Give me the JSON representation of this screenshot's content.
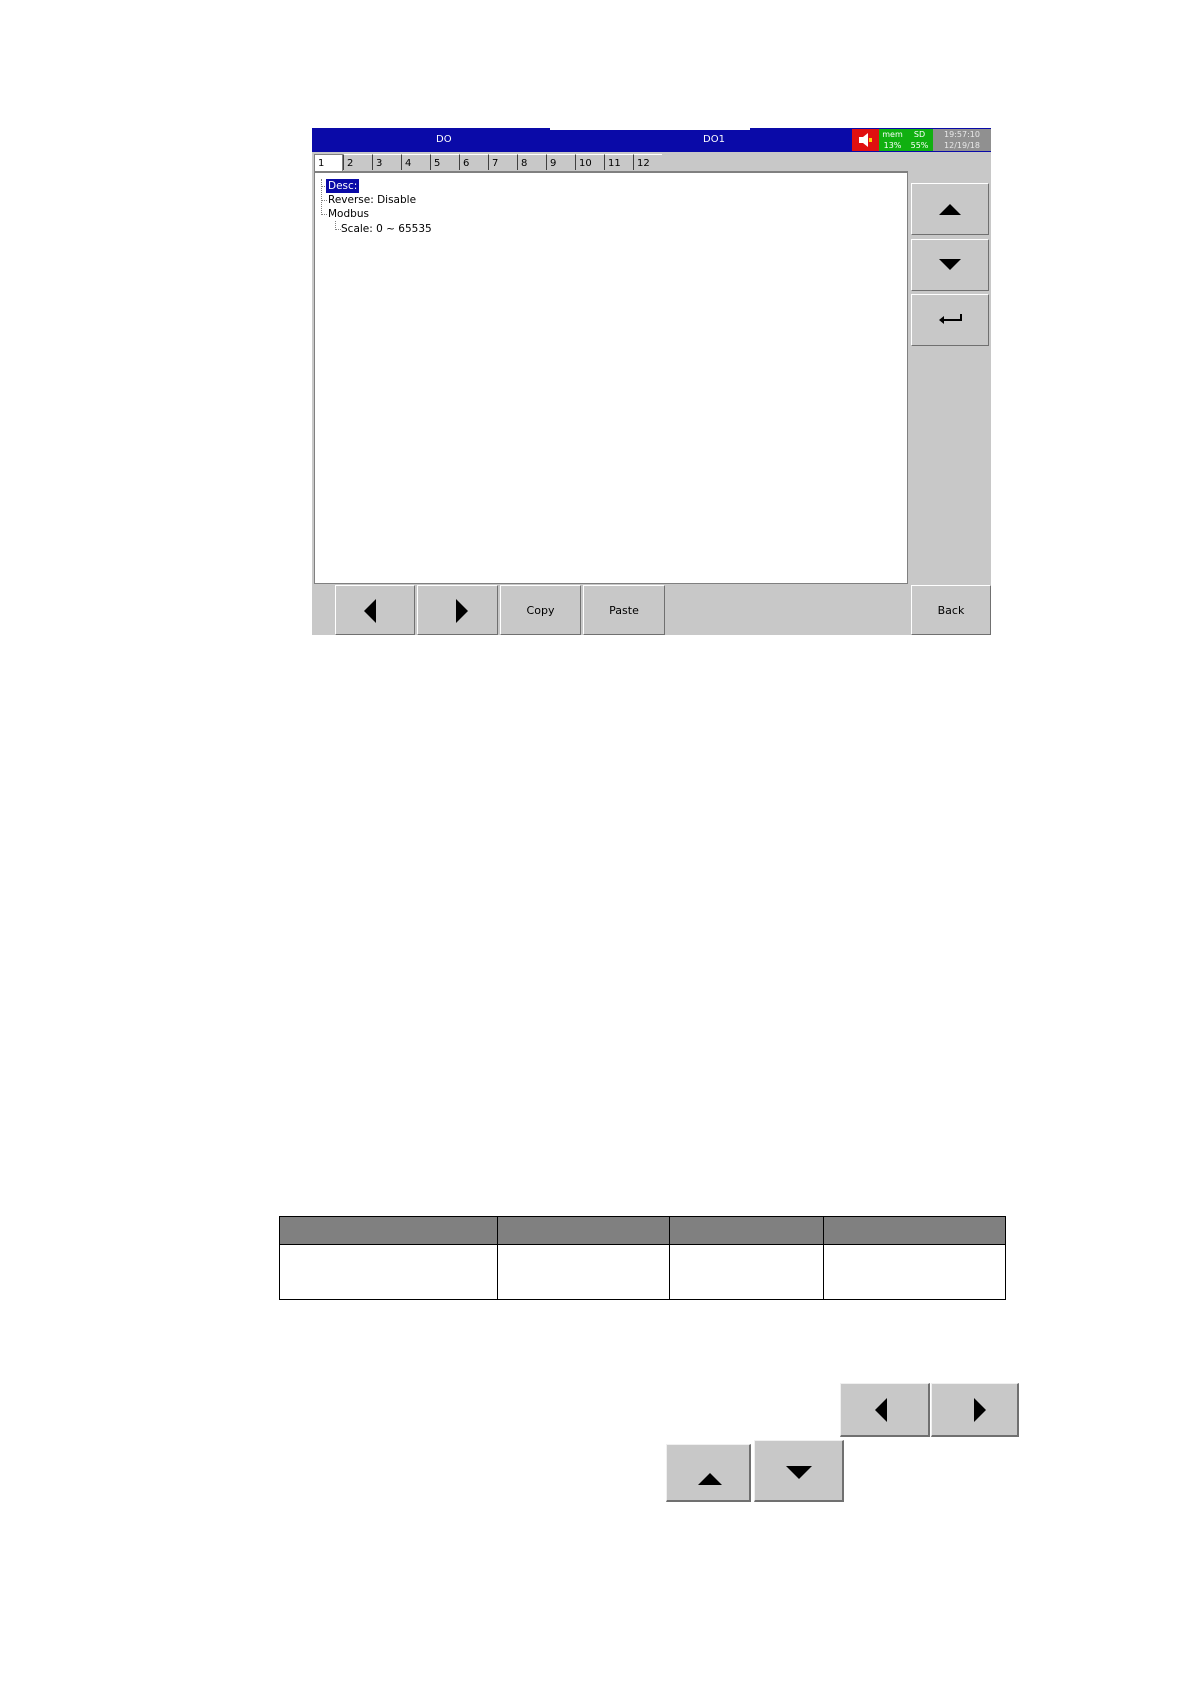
{
  "screen": {
    "title_left": "DO",
    "title_right": "DO1",
    "mem_label": "mem",
    "mem_value": "13%",
    "sd_label": "SD",
    "sd_value": "55%",
    "time": "19:57:10",
    "date": "12/19/18",
    "colors": {
      "titlebar": "#0a0aa8",
      "alarm": "#e01010",
      "status_green": "#10b010",
      "panel": "#c8c8c8"
    }
  },
  "tabs": [
    "1",
    "2",
    "3",
    "4",
    "5",
    "6",
    "7",
    "8",
    "9",
    "10",
    "11",
    "12"
  ],
  "active_tab": "1",
  "tree": {
    "desc": "Desc:",
    "reverse": "Reverse: Disable",
    "modbus": "Modbus",
    "scale": "Scale: 0 ~ 65535"
  },
  "buttons": {
    "copy": "Copy",
    "paste": "Paste",
    "back": "Back"
  },
  "icons": {
    "up": "arrow-up-icon",
    "down": "arrow-down-icon",
    "enter": "enter-icon",
    "left": "arrow-left-icon",
    "right": "arrow-right-icon",
    "speaker": "speaker-icon"
  }
}
